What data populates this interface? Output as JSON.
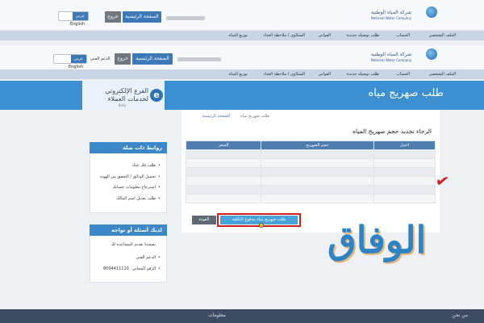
{
  "top_header": {
    "lang": [
      "عربي",
      "English"
    ],
    "logout": "خروج",
    "home": "الصفحة الرئيسية",
    "logo_ar": "شركة المياه الوطنية",
    "logo_en": "National Water Company"
  },
  "top_menu": [
    "الملف الشخصي",
    "الحساب",
    "طلب توصيلة جديدة",
    "الفواتير",
    "الشكاوى / ملاحظة",
    "العداد",
    "توزيع المياه"
  ],
  "header": {
    "lang": [
      "عربي",
      "English"
    ],
    "support": "الدعم الفني",
    "logout": "خروج",
    "home": "الصفحة الرئيسية",
    "logo_ar": "شركة المياه الوطنية",
    "logo_en": "National Water Company"
  },
  "menu": [
    "الملف الشخصي",
    "الحساب",
    "طلب توصيلة جديدة",
    "الفواتير",
    "الشكاوى / ملاحظة",
    "العداد",
    "توزيع المياه"
  ],
  "brand": {
    "line1": "الفرع الإلكتروني",
    "line2": "لخدمات العملاء",
    "beta": "Beta",
    "icon": "e-branch-icon"
  },
  "page": {
    "title": "طلب صهريج مياه",
    "breadcrumb_home": "الصفحة الرئيسية",
    "breadcrumb_current": "طلب صهريج مياه"
  },
  "form": {
    "question": "الرجاء تحديد حجم صهريج المياه",
    "columns": [
      "اختيار",
      "حجم الصهريج",
      "السعر"
    ],
    "rows": [
      [
        "",
        "",
        ""
      ],
      [
        "",
        "",
        ""
      ],
      [
        "",
        "",
        ""
      ],
      [
        "",
        "",
        ""
      ],
      [
        "",
        "",
        ""
      ],
      [
        "",
        "",
        ""
      ]
    ],
    "back_button": "العودة",
    "calc_button": "طلب صهريج مياه مدفوع التكلفة"
  },
  "sidebar": {
    "links_title": "روابط ذات صلة",
    "links": [
      "طلب فك عداد",
      "تحميل الوثائق / التحقق من الهوية",
      "استرجاع معلومات حسابك",
      "طلب تعديل اسم المالك"
    ],
    "help_title": "لديك أسئلة أو تواجه مشاكلاً؟",
    "help_text": "يسعدنا تقديم المساعدة لك",
    "support": "الدعم الفني",
    "phone_label": "الرقم المجاني",
    "phone": "8004411110"
  },
  "watermark": "الوفاق",
  "footer": {
    "about": "من نحن",
    "info": "معلومات"
  },
  "colors": {
    "banner": "#3c8fd1",
    "menu": "#c9d5e2",
    "table_header": "#4e7db0",
    "highlight": "#d21f1f",
    "watermark": "#2f83c4"
  }
}
